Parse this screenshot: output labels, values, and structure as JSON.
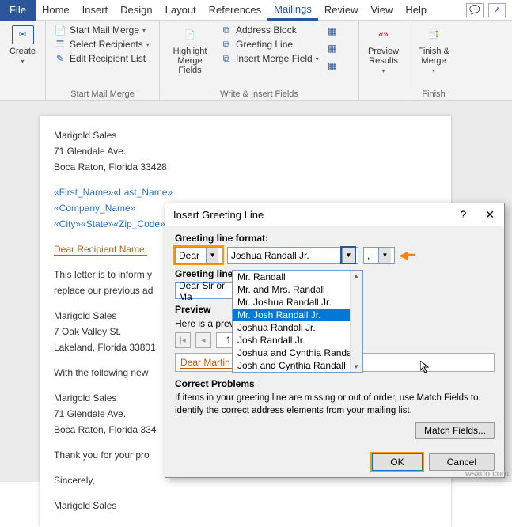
{
  "tabs": {
    "file": "File",
    "home": "Home",
    "insert": "Insert",
    "design": "Design",
    "layout": "Layout",
    "references": "References",
    "mailings": "Mailings",
    "review": "Review",
    "view": "View",
    "help": "Help"
  },
  "ribbon": {
    "create": "Create",
    "start_mail_merge": "Start Mail Merge",
    "select_recipients": "Select Recipients",
    "edit_recipient_list": "Edit Recipient List",
    "group_start": "Start Mail Merge",
    "highlight": "Highlight Merge Fields",
    "address_block": "Address Block",
    "greeting_line": "Greeting Line",
    "insert_merge_field": "Insert Merge Field",
    "group_write": "Write & Insert Fields",
    "preview": "Preview Results",
    "finish": "Finish & Merge",
    "group_finish": "Finish"
  },
  "doc": {
    "from": [
      "Marigold Sales",
      "71 Glendale Ave.",
      "Boca Raton, Florida 33428"
    ],
    "fields": [
      "«First_Name»«Last_Name»",
      "«Company_Name»",
      "«City»«State»«Zip_Code»"
    ],
    "greeting": "Dear Recipient Name,",
    "body1a": "This letter is to inform y",
    "body1b": "replace our previous ad",
    "addr2": [
      "Marigold Sales",
      "7 Oak Valley St.",
      "Lakeland, Florida 33801"
    ],
    "body2": "With the following new",
    "addr3": [
      "Marigold Sales",
      "71 Glendale Ave.",
      "Boca Raton, Florida 334"
    ],
    "body3": "Thank you for your pro",
    "close": "Sincerely,",
    "sig": "Marigold Sales"
  },
  "dialog": {
    "title": "Insert Greeting Line",
    "format_label": "Greeting line format:",
    "salutation": "Dear",
    "name_format": "Joshua Randall Jr.",
    "punct": ",",
    "invalid_label": "Greeting line for i",
    "invalid_value": "Dear Sir or Ma",
    "preview_label": "Preview",
    "preview_text": "Here is a preview f",
    "spin_value": "1",
    "preview_result": "Dear Martin Smith,",
    "correct_label": "Correct Problems",
    "correct_text": "If items in your greeting line are missing or out of order, use Match Fields to identify the correct address elements from your mailing list.",
    "match_fields": "Match Fields...",
    "ok": "OK",
    "cancel": "Cancel",
    "dropdown": [
      "Mr. Randall",
      "Mr. and Mrs. Randall",
      "Mr. Joshua Randall Jr.",
      "Mr. Josh Randall Jr.",
      "Joshua Randall Jr.",
      "Josh Randall Jr.",
      "Joshua and Cynthia Randall",
      "Josh and Cynthia Randall"
    ]
  },
  "watermark": "wsxdn.com"
}
